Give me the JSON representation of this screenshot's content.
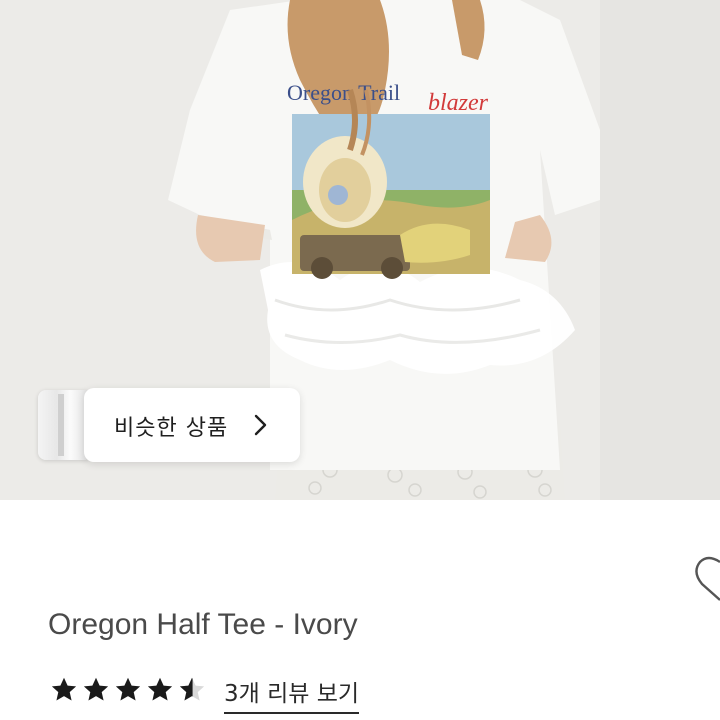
{
  "product_image": {
    "alt": "Oregon Half Tee - Ivory",
    "print_text_main": "Oregon Trail",
    "print_text_accent": "blazer"
  },
  "similar_products": {
    "label": "비슷한 상품"
  },
  "product": {
    "title": "Oregon Half Tee - Ivory"
  },
  "rating": {
    "value": 4.5,
    "max": 5,
    "reviews_link": "3개 리뷰 보기"
  },
  "icons": {
    "chevron": "chevron-right-icon",
    "like": "heart-icon",
    "rating": "star-icon"
  },
  "colors": {
    "star": "#1a1a1a",
    "text": "#4a4a4a",
    "print_blue": "#3b4f8a",
    "print_red": "#d23a3a"
  }
}
